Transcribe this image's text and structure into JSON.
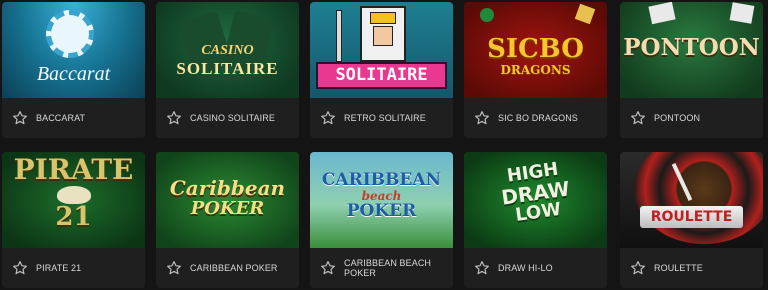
{
  "games": [
    {
      "label": "BACCARAT",
      "art": "Baccarat",
      "theme": "t-baccarat"
    },
    {
      "label": "CASINO SOLITAIRE",
      "art_line1": "CASINO",
      "art_line2": "SOLITAIRE",
      "theme": "t-casinosol"
    },
    {
      "label": "RETRO SOLITAIRE",
      "art": "SOLITAIRE",
      "theme": "t-retrosol"
    },
    {
      "label": "SIC BO DRAGONS",
      "art_line1": "SICBO",
      "art_line2": "DRAGONS",
      "theme": "t-sicbo"
    },
    {
      "label": "PONTOON",
      "art": "PONTOON",
      "theme": "t-pontoon"
    },
    {
      "label": "PIRATE 21",
      "art_line1": "PIRATE",
      "art_line2": "21",
      "theme": "t-pirate"
    },
    {
      "label": "CARIBBEAN POKER",
      "art_line1": "Caribbean",
      "art_line2": "POKER",
      "theme": "t-caribpoker"
    },
    {
      "label": "CARIBBEAN BEACH POKER",
      "art_line1": "CARIBBEAN",
      "art_line2": "beach",
      "art_line3": "POKER",
      "theme": "t-caribbeach"
    },
    {
      "label": "DRAW HI-LO",
      "art_line1": "HIGH",
      "art_line2": "DRAW",
      "art_line3": "LOW",
      "theme": "t-drawhilo"
    },
    {
      "label": "ROULETTE",
      "art": "ROULETTE",
      "theme": "t-roulette"
    }
  ],
  "icon": "star-outline-icon",
  "colors": {
    "background": "#141414",
    "card": "#202020",
    "label": "#d8d8d8"
  }
}
